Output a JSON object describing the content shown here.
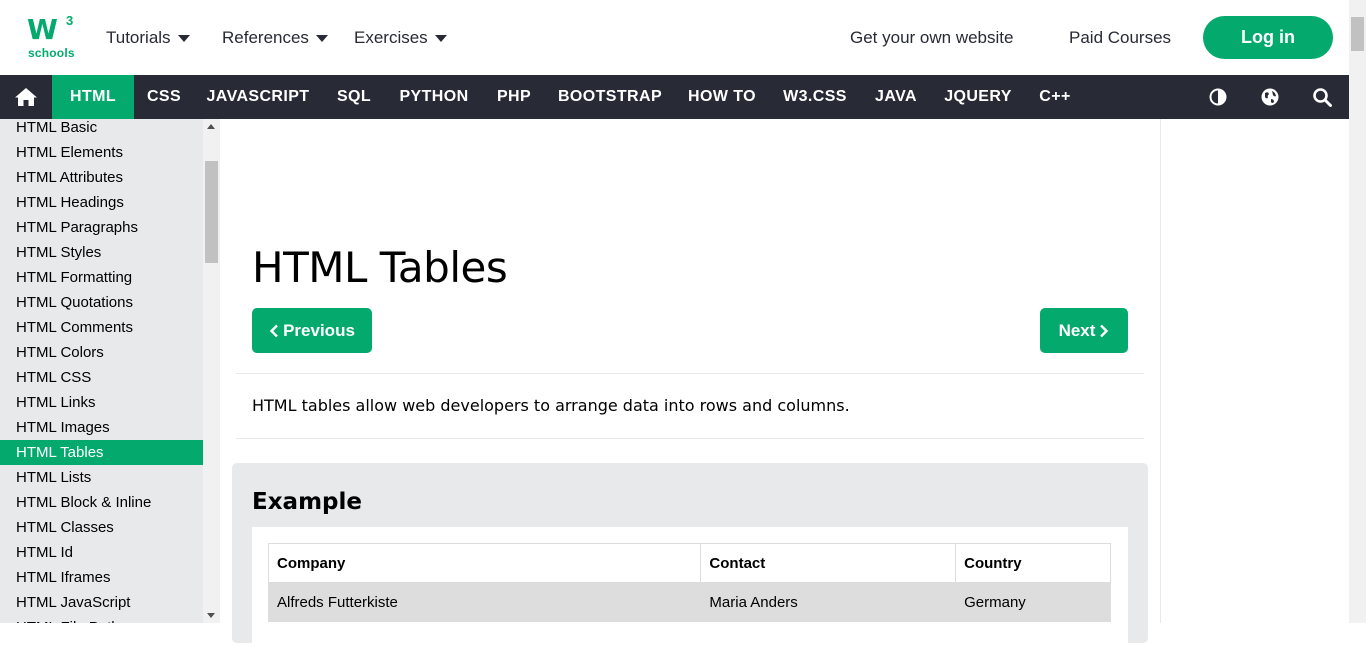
{
  "logo": {
    "mark": "W",
    "sup": "3",
    "text": "schools"
  },
  "header": {
    "menus": [
      "Tutorials",
      "References",
      "Exercises"
    ],
    "links": [
      "Get your own website",
      "Paid Courses"
    ],
    "login_label": "Log in"
  },
  "nav": {
    "items": [
      "HTML",
      "CSS",
      "JAVASCRIPT",
      "SQL",
      "PYTHON",
      "PHP",
      "BOOTSTRAP",
      "HOW TO",
      "W3.CSS",
      "JAVA",
      "JQUERY",
      "C++"
    ],
    "active": "HTML",
    "icons": [
      "home-icon",
      "contrast-icon",
      "globe-icon",
      "search-icon"
    ]
  },
  "sidebar": {
    "items": [
      "HTML Basic",
      "HTML Elements",
      "HTML Attributes",
      "HTML Headings",
      "HTML Paragraphs",
      "HTML Styles",
      "HTML Formatting",
      "HTML Quotations",
      "HTML Comments",
      "HTML Colors",
      "HTML CSS",
      "HTML Links",
      "HTML Images",
      "HTML Tables",
      "HTML Lists",
      "HTML Block & Inline",
      "HTML Classes",
      "HTML Id",
      "HTML Iframes",
      "HTML JavaScript",
      "HTML File Paths"
    ],
    "active": "HTML Tables"
  },
  "main": {
    "title": "HTML Tables",
    "prev_label": "Previous",
    "next_label": "Next",
    "intro": "HTML tables allow web developers to arrange data into rows and columns.",
    "example_title": "Example",
    "table": {
      "headers": [
        "Company",
        "Contact",
        "Country"
      ],
      "rows": [
        [
          "Alfreds Futterkiste",
          "Maria Anders",
          "Germany"
        ]
      ]
    }
  },
  "colors": {
    "brand": "#04AA6D",
    "navbar": "#282A35",
    "sidebar": "#E7E9EB"
  }
}
